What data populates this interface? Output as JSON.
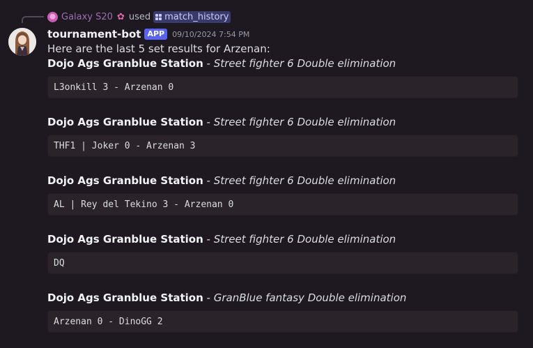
{
  "interaction": {
    "user": "Galaxy S20",
    "flower_icon": "flower-icon",
    "used_label": "used",
    "command": "match_history"
  },
  "author": {
    "name": "tournament-bot",
    "badge": "APP",
    "timestamp": "09/10/2024 7:54 PM"
  },
  "intro": "Here are the last 5 set results for Arzenan:",
  "results": [
    {
      "event": "Dojo Ags Granblue Station",
      "separator": " - ",
      "game": "Street fighter 6 Double elimination",
      "score": "L3onkill 3 - Arzenan 0"
    },
    {
      "event": "Dojo Ags Granblue Station",
      "separator": " - ",
      "game": "Street fighter 6 Double elimination",
      "score": "THF1 | Joker 0 - Arzenan 3"
    },
    {
      "event": "Dojo Ags Granblue Station",
      "separator": " - ",
      "game": "Street fighter 6 Double elimination",
      "score": "AL | Rey del Tekino 3 - Arzenan 0"
    },
    {
      "event": "Dojo Ags Granblue Station",
      "separator": " - ",
      "game": "Street fighter 6 Double elimination",
      "score": "DQ"
    },
    {
      "event": "Dojo Ags Granblue Station",
      "separator": " - ",
      "game": "GranBlue fantasy Double elimination",
      "score": "Arzenan 0 - DinoGG 2"
    }
  ],
  "colors": {
    "background": "#1e1821",
    "code_background": "#2a2329",
    "badge": "#5865f2",
    "command_pill": "#3a3a6a",
    "interaction_user": "#9a6fb0"
  }
}
